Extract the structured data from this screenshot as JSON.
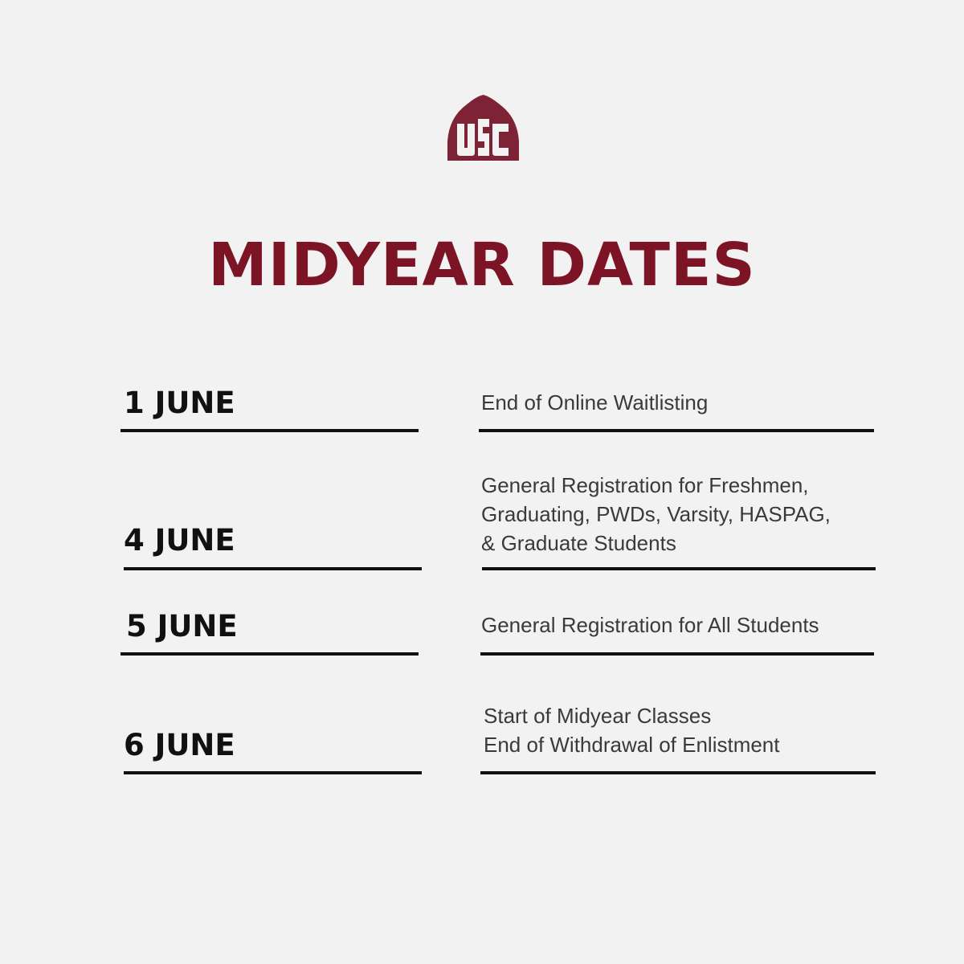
{
  "logo": {
    "text": "USC",
    "color": "#7d2335"
  },
  "title": "MIDYEAR DATES",
  "accent_color": "#7d1426",
  "schedule": [
    {
      "date": "1 JUNE",
      "event_lines": [
        "End of Online Waitlisting"
      ]
    },
    {
      "date": "4 JUNE",
      "event_lines": [
        "General Registration for Freshmen,",
        "Graduating, PWDs, Varsity, HASPAG,",
        "& Graduate Students"
      ]
    },
    {
      "date": "5 JUNE",
      "event_lines": [
        "General Registration for All Students"
      ]
    },
    {
      "date": "6 JUNE",
      "event_lines": [
        "Start of Midyear Classes",
        "End of Withdrawal of Enlistment"
      ]
    }
  ]
}
